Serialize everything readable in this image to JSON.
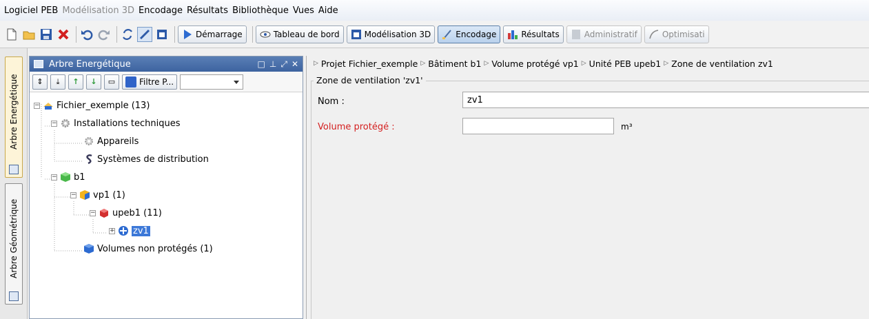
{
  "menu": [
    "Logiciel PEB",
    "Modélisation 3D",
    "Encodage",
    "Résultats",
    "Bibliothèque",
    "Vues",
    "Aide"
  ],
  "menu_disabled": [
    "Modélisation 3D"
  ],
  "toolbar": {
    "demarrage": "Démarrage",
    "tableau": "Tableau de bord",
    "modelisation": "Modélisation 3D",
    "encodage": "Encodage",
    "resultats": "Résultats",
    "administratif": "Administratif",
    "optimisation": "Optimisati"
  },
  "sidetabs": {
    "energetique": "Arbre Energétique",
    "geometrique": "Arbre Géométrique"
  },
  "left_panel": {
    "title": "Arbre Energétique",
    "filter_label": "Filtre P...",
    "filter_value": ""
  },
  "tree": {
    "root": "Fichier_exemple (13)",
    "installations": "Installations techniques",
    "appareils": "Appareils",
    "systemes": "Systèmes de distribution",
    "b1": "b1",
    "vp1": "vp1 (1)",
    "upeb1": "upeb1 (11)",
    "zv1": "zv1",
    "non_proteges": "Volumes non protégés (1)"
  },
  "breadcrumb": [
    "Projet Fichier_exemple",
    "Bâtiment b1",
    "Volume protégé vp1",
    "Unité PEB upeb1",
    "Zone de ventilation zv1"
  ],
  "form": {
    "group_title": "Zone de ventilation 'zv1'",
    "nom_label": "Nom :",
    "nom_value": "zv1",
    "volume_label": "Volume protégé :",
    "volume_value": "",
    "volume_unit": "m³"
  },
  "colors": {
    "accent": "#3c78d8",
    "title_bar": "#3d63a0",
    "required": "#d42020"
  }
}
